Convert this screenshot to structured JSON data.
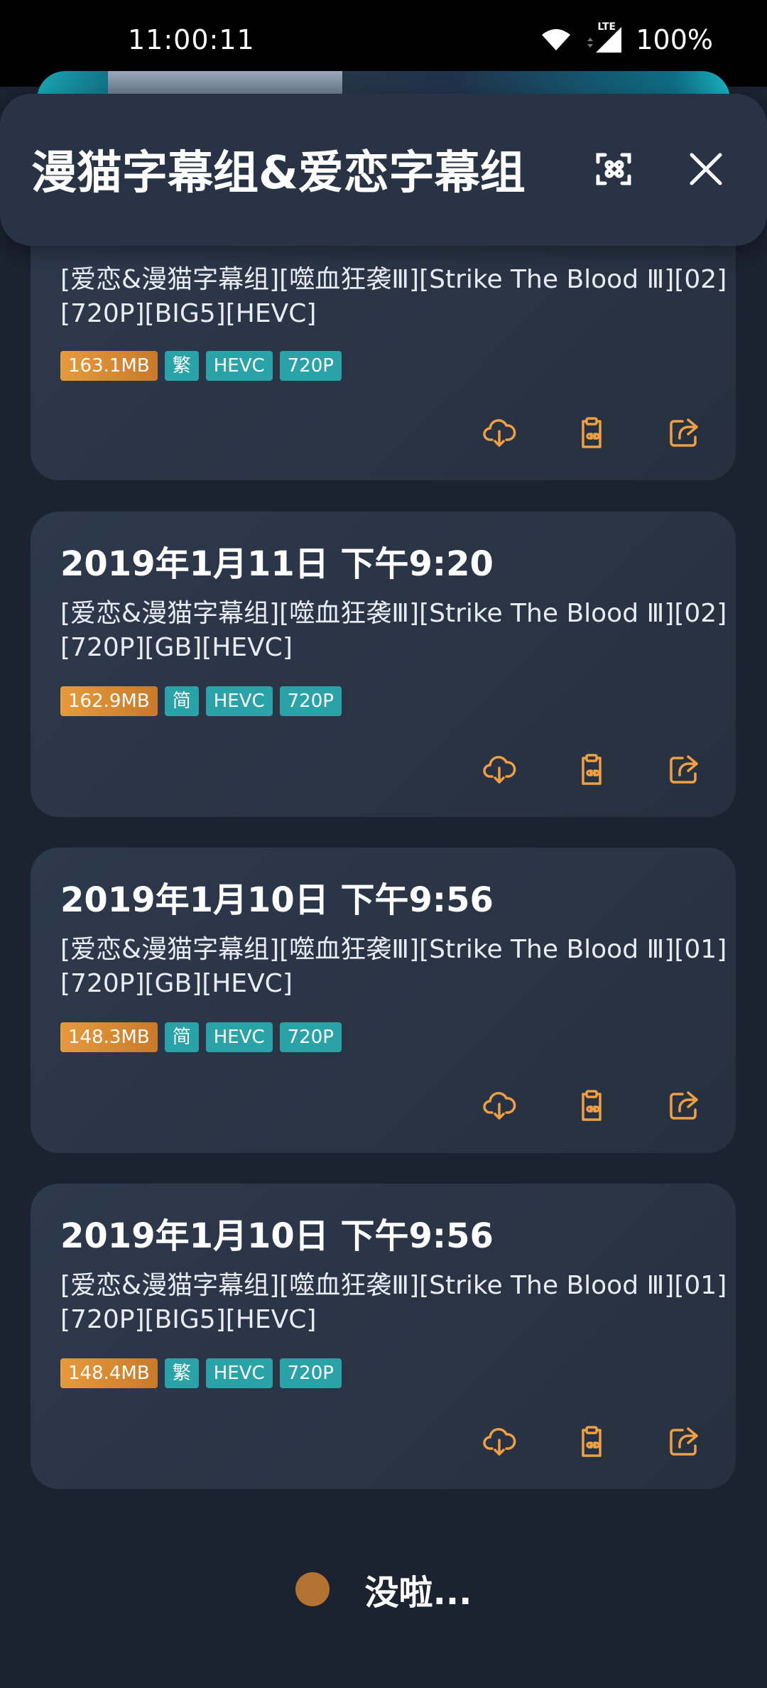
{
  "status_bar": {
    "time": "11:00:11",
    "network": "LTE",
    "battery": "100%"
  },
  "header": {
    "title": "漫猫字幕组&爱恋字幕组",
    "scan_icon": "scan-icon",
    "close_icon": "close-icon"
  },
  "accent_color": "#f0a043",
  "items": [
    {
      "date": "",
      "description": "[爱恋&漫猫字幕组][噬血狂袭Ⅲ][Strike The Blood Ⅲ][02][720P][BIG5][HEVC]",
      "tags": {
        "size": "163.1MB",
        "lang": "繁",
        "codec": "HEVC",
        "resolution": "720P"
      }
    },
    {
      "date": "2019年1月11日 下午9:20",
      "description": "[爱恋&漫猫字幕组][噬血狂袭Ⅲ][Strike The Blood Ⅲ][02][720P][GB][HEVC]",
      "tags": {
        "size": "162.9MB",
        "lang": "简",
        "codec": "HEVC",
        "resolution": "720P"
      }
    },
    {
      "date": "2019年1月10日 下午9:56",
      "description": "[爱恋&漫猫字幕组][噬血狂袭Ⅲ][Strike The Blood Ⅲ][01][720P][GB][HEVC]",
      "tags": {
        "size": "148.3MB",
        "lang": "简",
        "codec": "HEVC",
        "resolution": "720P"
      }
    },
    {
      "date": "2019年1月10日 下午9:56",
      "description": "[爱恋&漫猫字幕组][噬血狂袭Ⅲ][Strike The Blood Ⅲ][01][720P][BIG5][HEVC]",
      "tags": {
        "size": "148.4MB",
        "lang": "繁",
        "codec": "HEVC",
        "resolution": "720P"
      }
    }
  ],
  "footer": {
    "text": "没啦..."
  }
}
